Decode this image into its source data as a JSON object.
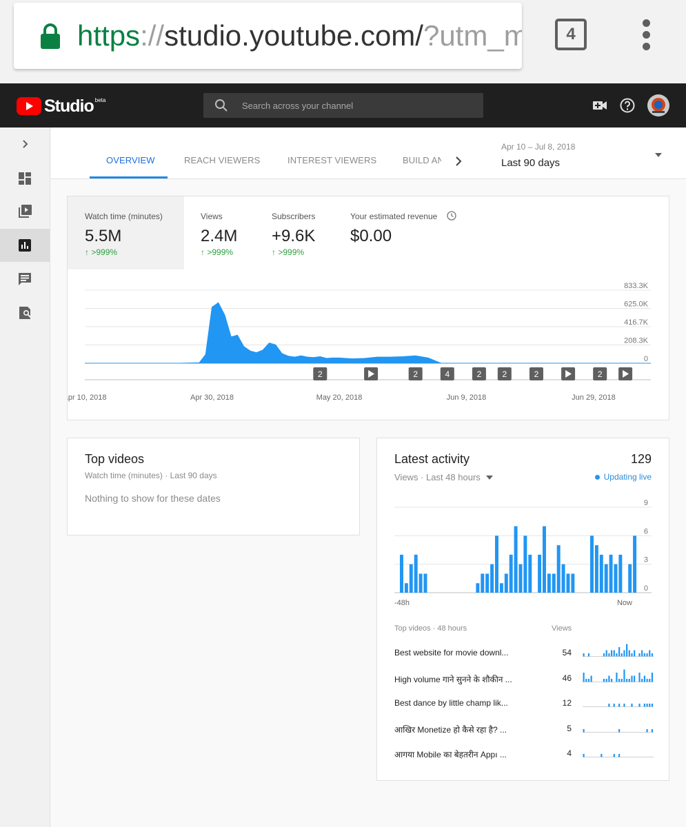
{
  "browser": {
    "url_scheme": "https",
    "url_sep": "://",
    "url_host": "studio.youtube.com/",
    "url_rest": "?utm_m",
    "tab_count": "4"
  },
  "header": {
    "logo_text": "Studio",
    "beta_label": "beta",
    "search_placeholder": "Search across your channel"
  },
  "tabs": [
    "OVERVIEW",
    "REACH VIEWERS",
    "INTEREST VIEWERS",
    "BUILD AN"
  ],
  "date": {
    "range_small": "Apr 10 – Jul 8, 2018",
    "range_label": "Last 90 days"
  },
  "metrics": [
    {
      "label": "Watch time (minutes)",
      "value": "5.5M",
      "delta": ">999%"
    },
    {
      "label": "Views",
      "value": "2.4M",
      "delta": ">999%"
    },
    {
      "label": "Subscribers",
      "value": "+9.6K",
      "delta": ">999%"
    },
    {
      "label": "Your estimated revenue",
      "value": "$0.00",
      "delta": ""
    }
  ],
  "colors": {
    "accent_blue": "#2196f3",
    "tab_active": "#1e6fd9",
    "delta_green": "#2e9e3e",
    "header_bg": "#1f1f1f",
    "youtube_red": "#ff0000"
  },
  "chart_data": [
    {
      "type": "area",
      "y_tick_labels": [
        "833.3K",
        "625.0K",
        "416.7K",
        "208.3K",
        "0"
      ],
      "ylim": [
        0,
        833300
      ],
      "x_tick_labels": [
        "Apr 10, 2018",
        "Apr 30, 2018",
        "May 20, 2018",
        "Jun 9, 2018",
        "Jun 29, 2018"
      ],
      "x": [
        "Apr 10",
        "Apr 13",
        "Apr 16",
        "Apr 19",
        "Apr 22",
        "Apr 25",
        "Apr 28",
        "Apr 29",
        "Apr 30",
        "May 1",
        "May 2",
        "May 3",
        "May 4",
        "May 5",
        "May 6",
        "May 7",
        "May 8",
        "May 9",
        "May 10",
        "May 11",
        "May 12",
        "May 13",
        "May 14",
        "May 15",
        "May 16",
        "May 17",
        "May 18",
        "May 19",
        "May 20",
        "May 22",
        "May 24",
        "May 26",
        "May 28",
        "May 30",
        "Jun 1",
        "Jun 3",
        "Jun 5",
        "Jul 8"
      ],
      "series": [
        {
          "values": [
            0,
            0,
            0,
            0,
            0,
            0,
            5000,
            100000,
            640000,
            690000,
            550000,
            300000,
            320000,
            190000,
            140000,
            120000,
            150000,
            230000,
            210000,
            110000,
            80000,
            70000,
            85000,
            70000,
            65000,
            75000,
            55000,
            60000,
            60000,
            50000,
            55000,
            70000,
            70000,
            75000,
            85000,
            60000,
            0,
            0
          ]
        }
      ],
      "events": [
        {
          "date": "May 17",
          "label": "2"
        },
        {
          "date": "May 25",
          "label": "▶"
        },
        {
          "date": "Jun 1",
          "label": "2"
        },
        {
          "date": "Jun 6",
          "label": "4"
        },
        {
          "date": "Jun 11",
          "label": "2"
        },
        {
          "date": "Jun 15",
          "label": "2"
        },
        {
          "date": "Jun 20",
          "label": "2"
        },
        {
          "date": "Jun 25",
          "label": "▶"
        },
        {
          "date": "Jun 30",
          "label": "2"
        },
        {
          "date": "Jul 4",
          "label": "▶"
        }
      ],
      "grid": true
    },
    {
      "type": "bar",
      "y_tick_labels": [
        "9",
        "6",
        "3",
        "0"
      ],
      "ylim": [
        0,
        9
      ],
      "x_tick_labels": [
        "-48h",
        "Now"
      ],
      "values": [
        4,
        1,
        3,
        4,
        2,
        2,
        0,
        0,
        0,
        0,
        0,
        0,
        0,
        0,
        0,
        0,
        1,
        2,
        2,
        3,
        6,
        1,
        2,
        4,
        7,
        3,
        6,
        4,
        0,
        4,
        7,
        2,
        2,
        5,
        3,
        2,
        2,
        0,
        0,
        0,
        6,
        5,
        4,
        3,
        4,
        3,
        4,
        0,
        3,
        6
      ],
      "grid": true
    }
  ],
  "top_videos": {
    "title": "Top videos",
    "subtitle": "Watch time (minutes) · Last 90 days",
    "empty": "Nothing to show for these dates"
  },
  "activity": {
    "title": "Latest activity",
    "count": "129",
    "subtitle": "Views · Last 48 hours",
    "live": "Updating live",
    "list_head": "Top videos · 48 hours",
    "views_head": "Views",
    "videos": [
      {
        "title": "Best website for movie downl...",
        "views": "54",
        "spark": [
          1,
          0,
          1,
          0,
          0,
          0,
          0,
          0,
          1,
          2,
          1,
          2,
          2,
          1,
          3,
          1,
          2,
          4,
          2,
          1,
          2,
          0,
          1,
          2,
          1,
          1,
          2,
          1
        ]
      },
      {
        "title": "High volume गाने सुनने के शौकीन ...",
        "views": "46",
        "spark": [
          3,
          1,
          1,
          2,
          0,
          0,
          0,
          0,
          1,
          1,
          2,
          1,
          0,
          3,
          1,
          1,
          4,
          1,
          1,
          2,
          2,
          0,
          3,
          1,
          2,
          1,
          1,
          3
        ]
      },
      {
        "title": "Best dance by little champ lik...",
        "views": "12",
        "spark": [
          0,
          0,
          0,
          0,
          0,
          0,
          0,
          0,
          0,
          0,
          1,
          0,
          1,
          0,
          1,
          0,
          1,
          0,
          0,
          1,
          0,
          0,
          1,
          0,
          1,
          1,
          1,
          1
        ]
      },
      {
        "title": "आखिर Monetize हो कैसे रहा है? ...",
        "views": "5",
        "spark": [
          1,
          0,
          0,
          0,
          0,
          0,
          0,
          0,
          0,
          0,
          0,
          0,
          0,
          0,
          1,
          0,
          0,
          0,
          0,
          0,
          0,
          0,
          0,
          0,
          0,
          1,
          0,
          1
        ]
      },
      {
        "title": "आगया Mobile का बेहतरीन Appı ...",
        "views": "4",
        "spark": [
          1,
          0,
          0,
          0,
          0,
          0,
          0,
          1,
          0,
          0,
          0,
          0,
          1,
          0,
          1,
          0,
          0,
          0,
          0,
          0,
          0,
          0,
          0,
          0,
          0,
          0,
          0,
          0
        ]
      }
    ]
  }
}
